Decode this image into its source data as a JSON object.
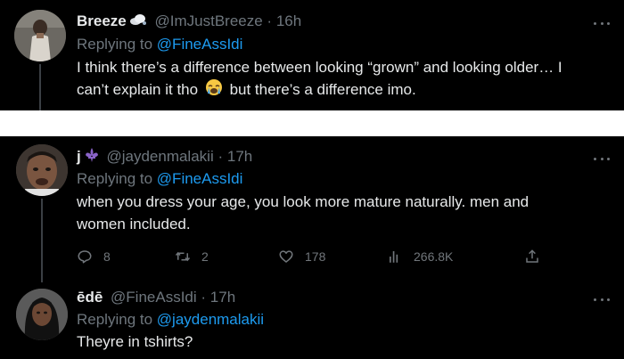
{
  "tweets": [
    {
      "display_name": "Breeze",
      "handle": "@ImJustBreeze",
      "separator": "·",
      "time": "16h",
      "replying_prefix": "Replying to",
      "replying_to": "@FineAssIdi",
      "text_line_1": "I think there’s a difference between looking “grown” and looking older… I",
      "text_line_2_a": "can’t explain it tho",
      "text_line_2_b": "but there’s a difference imo."
    },
    {
      "display_name": "j",
      "handle": "@jaydenmalakii",
      "separator": "·",
      "time": "17h",
      "replying_prefix": "Replying to",
      "replying_to": "@FineAssIdi",
      "text_line_1": "when you dress your age, you look more mature naturally. men and",
      "text_line_2": "women included.",
      "stats": {
        "replies": "8",
        "retweets": "2",
        "likes": "178",
        "views": "266.8K"
      }
    },
    {
      "display_name": "ēdē",
      "handle": "@FineAssIdi",
      "separator": "·",
      "time": "17h",
      "replying_prefix": "Replying to",
      "replying_to": "@jaydenmalakii",
      "text_line_1": "Theyre in tshirts?"
    }
  ],
  "colors": {
    "background": "#000000",
    "text_primary": "#e7e9ea",
    "text_secondary": "#6e767d",
    "link": "#1d9bf0",
    "thread_line": "#3b3f44"
  },
  "icons": [
    "cloud-emoji-icon",
    "fleur-de-lis-emoji-icon",
    "crying-face-emoji-icon",
    "more-icon",
    "reply-icon",
    "retweet-icon",
    "like-icon",
    "views-icon",
    "share-icon"
  ]
}
